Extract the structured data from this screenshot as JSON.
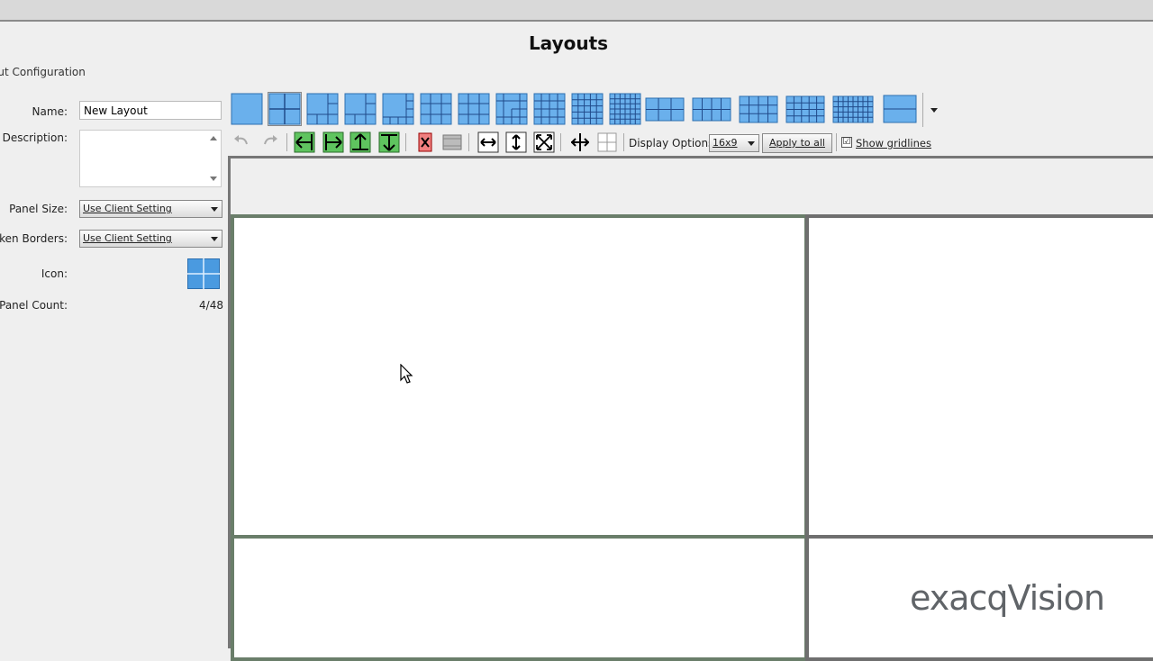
{
  "window": {
    "title": "Layouts"
  },
  "sidebar": {
    "section_label": "out Configuration",
    "name_label": "Name:",
    "name_value": "New Layout",
    "description_label": "Description:",
    "panel_size_label": "Panel Size:",
    "panel_size_value": "Use Client Setting",
    "sunken_borders_label": "unken Borders:",
    "sunken_borders_value": "Use Client Setting",
    "icon_label": "Icon:",
    "panel_count_label": "Panel Count:",
    "panel_count_value": "4/48"
  },
  "layout_presets": {
    "selected_index": 1,
    "icons": [
      "layout-1x1-icon",
      "layout-2x2-icon",
      "layout-1plus3-icon",
      "layout-1plus5-icon",
      "layout-1plus7-icon",
      "layout-3x3-icon",
      "layout-1plus8-icon",
      "layout-1plus12-icon",
      "layout-4x4-icon",
      "layout-5x5-icon",
      "layout-6x6-icon",
      "layout-wide-6-icon",
      "layout-wide-8-icon",
      "layout-wide-12-icon",
      "layout-wide-16-icon",
      "layout-wide-32-icon",
      "layout-wide-2-icon"
    ]
  },
  "toolbar": {
    "display_options_label": "Display Options:",
    "aspect_value": "16x9",
    "apply_label": "Apply to all",
    "show_gridlines_label": "Show gridlines",
    "show_gridlines_checked": "☑"
  },
  "colors": {
    "panel_selected_border": "#6a7e6a",
    "panel_border": "#6f6f6f",
    "icon_blue": "#4a9ae0",
    "arrow_green": "#5fc45f"
  },
  "brand": {
    "text": "exacqVision"
  }
}
